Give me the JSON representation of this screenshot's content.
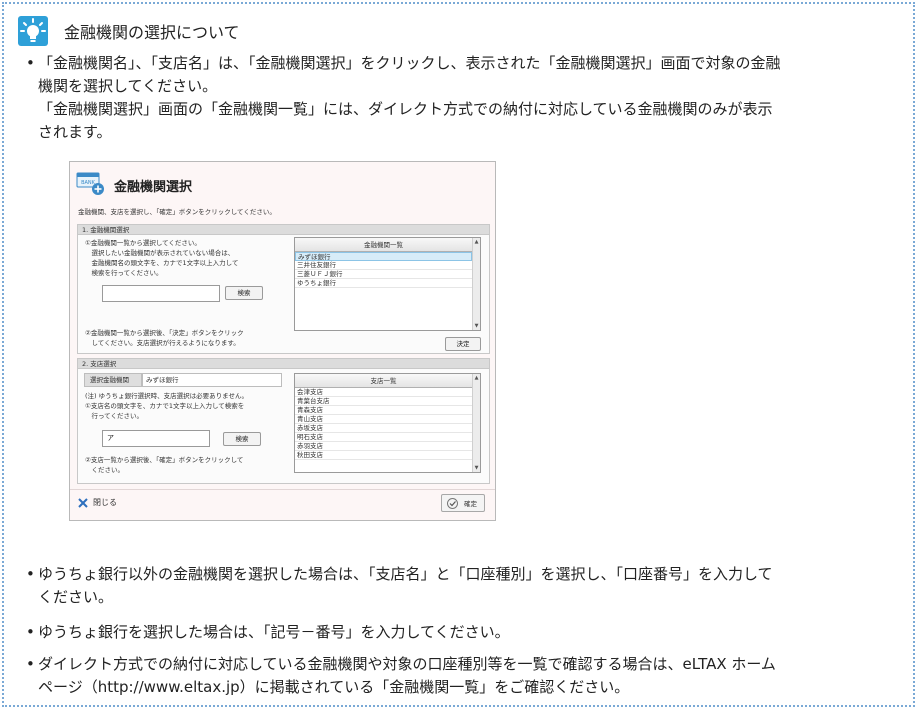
{
  "tip": {
    "title": "金融機関の選択について",
    "bullet": "•",
    "paragraph1": "「金融機関名」、「支店名」は、「金融機関選択」をクリックし、表示された「金融機関選択」画面で対象の金融\n機関を選択してください。\n「金融機関選択」画面の「金融機関一覧」には、ダイレクト方式での納付に対応している金融機関のみが表示\nされます。",
    "paragraph2": "ゆうちょ銀行以外の金融機関を選択した場合は、「支店名」と「口座種別」を選択し、「口座番号」を入力して\nください。",
    "paragraph3": "ゆうちょ銀行を選択した場合は、「記号－番号」を入力してください。",
    "paragraph4": "ダイレクト方式での納付に対応している金融機関や対象の口座種別等を一覧で確認する場合は、eLTAX ホーム\nページ（http://www.eltax.jp）に掲載されている「金融機関一覧」をご確認ください。"
  },
  "dialog": {
    "bank_icon_text": "BANK",
    "title": "金融機関選択",
    "instruction": "金融機関、支店を選択し、「確定」ボタンをクリックしてください。",
    "section1": {
      "header": "1. 金融機関選択",
      "step1": "①金融機関一覧から選択してください。\n　選択したい金融機関が表示されていない場合は、\n　金融機関名の頭文字を、カナで1文字以上入力して\n　検索を行ってください。",
      "search_value": "",
      "search_button": "検索",
      "step2": "②金融機関一覧から選択後、「決定」ボタンをクリック\n　してください。支店選択が行えるようになります。",
      "decide_button": "決定",
      "list_header": "金融機関一覧",
      "list_items": [
        "みずほ銀行",
        "三井住友銀行",
        "三菱ＵＦＪ銀行",
        "ゆうちょ銀行"
      ],
      "selected_index": 0
    },
    "section2": {
      "header": "2. 支店選択",
      "selected_bank_label": "選択金融機関",
      "selected_bank_value": "みずほ銀行",
      "note": "(注) ゆうちょ銀行選択時、支店選択は必要ありません。",
      "step1": "①支店名の頭文字を、カナで1文字以上入力して検索を\n　行ってください。",
      "search_value": "ア",
      "search_button": "検索",
      "step2": "②支店一覧から選択後、「確定」ボタンをクリックして\n　ください。",
      "list_header": "支店一覧",
      "list_items": [
        "会津支店",
        "青葉台支店",
        "青森支店",
        "青山支店",
        "赤坂支店",
        "明石支店",
        "赤羽支店",
        "秋田支店"
      ],
      "selected_index": 0
    },
    "close_label": "閉じる",
    "confirm_label": "確定",
    "scroll_up": "▲",
    "scroll_down": "▼"
  },
  "colors": {
    "tip_border": "#7aa9d6",
    "bulb": "#2ea0d8",
    "dialog_bg": "#fdf6f6",
    "list_selected": "#d7ecf8",
    "close_x": "#2e6fbd"
  }
}
